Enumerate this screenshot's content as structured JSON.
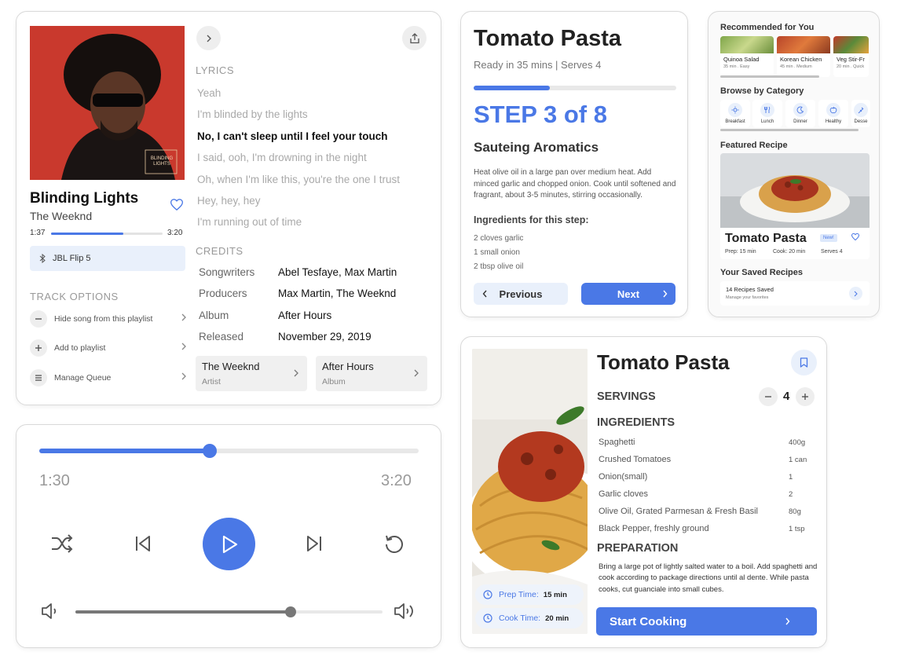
{
  "music": {
    "album_label": "BLINDING LIGHTS",
    "song_title": "Blinding Lights",
    "artist": "The Weeknd",
    "time_current": "1:37",
    "time_total": "3:20",
    "progress_fraction": 0.65,
    "device": "JBL Flip 5",
    "track_options_heading": "TRACK OPTIONS",
    "track_options": [
      {
        "label": "Hide song from this playlist",
        "icon": "minus-icon"
      },
      {
        "label": "Add to playlist",
        "icon": "plus-icon"
      },
      {
        "label": "Manage Queue",
        "icon": "queue-icon"
      }
    ],
    "lyrics_heading": "LYRICS",
    "lyrics": [
      "Yeah",
      "I'm blinded by the lights",
      "No, I can't sleep until I feel your touch",
      "I said, ooh, I'm drowning in the night",
      "Oh, when I'm like this, you're the one I trust",
      "Hey, hey, hey",
      "I'm running out of time"
    ],
    "active_lyric_index": 2,
    "credits_heading": "CREDITS",
    "credits": [
      {
        "key": "Songwriters",
        "value": "Abel Tesfaye, Max Martin"
      },
      {
        "key": "Producers",
        "value": "Max Martin, The Weeknd"
      },
      {
        "key": "Album",
        "value": "After Hours"
      },
      {
        "key": "Released",
        "value": "November 29, 2019"
      }
    ],
    "links": [
      {
        "title": "The Weeknd",
        "subtitle": "Artist"
      },
      {
        "title": "After Hours",
        "subtitle": "Album"
      }
    ]
  },
  "player": {
    "time_current": "1:30",
    "time_total": "3:20",
    "progress_fraction": 0.45,
    "volume_fraction": 0.7
  },
  "step": {
    "title": "Tomato Pasta",
    "subtitle": "Ready in 35 mins | Serves 4",
    "progress_fraction": 0.375,
    "step_label": "STEP 3 of 8",
    "step_name": "Sauteing Aromatics",
    "description": "Heat olive oil in a large pan over medium heat. Add minced garlic and chopped onion. Cook until softened and fragrant, about 3-5 minutes, stirring occasionally.",
    "ingredients_heading": "Ingredients for this step:",
    "ingredients": [
      "2 cloves garlic",
      "1 small onion",
      "2 tbsp olive oil"
    ],
    "prev_label": "Previous",
    "next_label": "Next"
  },
  "browse": {
    "recommended_heading": "Recommended for You",
    "recommended": [
      {
        "name": "Quinoa Salad",
        "meta": "35 min . Easy"
      },
      {
        "name": "Korean Chicken",
        "meta": "45 min . Medium"
      },
      {
        "name": "Veg Stir-Fr",
        "meta": "20 min . Quick"
      }
    ],
    "category_heading": "Browse by Category",
    "categories": [
      {
        "label": "Breakfast",
        "icon": "sun-icon"
      },
      {
        "label": "Lunch",
        "icon": "utensils-icon"
      },
      {
        "label": "Dinner",
        "icon": "moon-icon"
      },
      {
        "label": "Healthy",
        "icon": "apple-icon"
      },
      {
        "label": "Desse",
        "icon": "dessert-icon"
      }
    ],
    "featured_heading": "Featured Recipe",
    "featured": {
      "name": "Tomato Pasta",
      "badge": "New!",
      "prep": "Prep: 15 min",
      "cook": "Cook: 20 min",
      "serves": "Serves 4"
    },
    "saved_heading": "Your Saved Recipes",
    "saved_title": "14 Recipes Saved",
    "saved_subtitle": "Manage your favorites"
  },
  "recipe": {
    "title": "Tomato Pasta",
    "servings_heading": "SERVINGS",
    "servings": "4",
    "ingredients_heading": "INGREDIENTS",
    "ingredients": [
      {
        "name": "Spaghetti",
        "qty": "400g"
      },
      {
        "name": "Crushed Tomatoes",
        "qty": "1 can"
      },
      {
        "name": "Onion(small)",
        "qty": "1"
      },
      {
        "name": "Garlic cloves",
        "qty": "2"
      },
      {
        "name": "Olive Oil, Grated Parmesan & Fresh Basil",
        "qty": "80g"
      },
      {
        "name": "Black Pepper, freshly ground",
        "qty": "1 tsp"
      }
    ],
    "preparation_heading": "PREPARATION",
    "preparation": "Bring a large pot of lightly salted water to a boil. Add spaghetti and cook according to package directions until al dente. While pasta cooks, cut guanciale into small cubes.",
    "prep_time_label": "Prep Time:",
    "prep_time": "15 min",
    "cook_time_label": "Cook Time:",
    "cook_time": "20 min",
    "start_label": "Start Cooking"
  },
  "colors": {
    "accent": "#4a78e6",
    "accent_light": "#e9f0fb",
    "album_red": "#c9392d"
  }
}
